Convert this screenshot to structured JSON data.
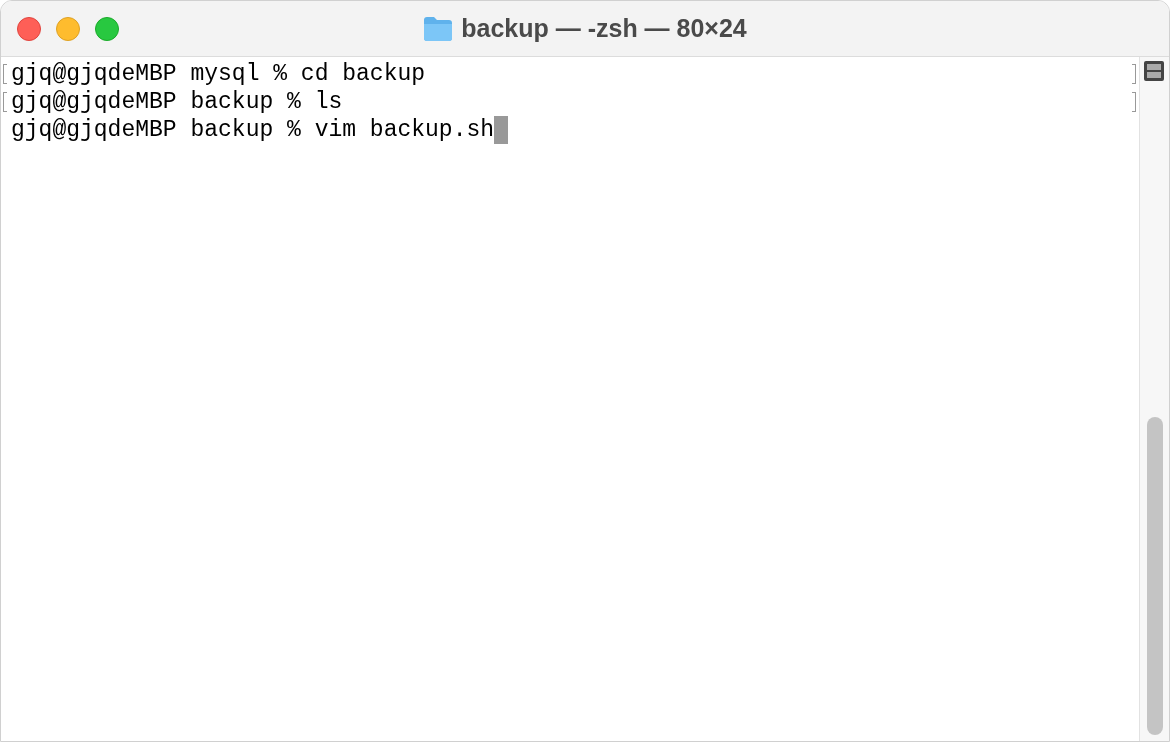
{
  "window": {
    "title": "backup — -zsh — 80×24"
  },
  "terminal": {
    "lines": [
      {
        "text": "gjq@gjqdeMBP mysql % cd backup",
        "marked": true
      },
      {
        "text": "gjq@gjqdeMBP backup % ls",
        "marked": true
      },
      {
        "text": "gjq@gjqdeMBP backup % vim backup.sh",
        "marked": false,
        "cursor": true
      }
    ]
  }
}
